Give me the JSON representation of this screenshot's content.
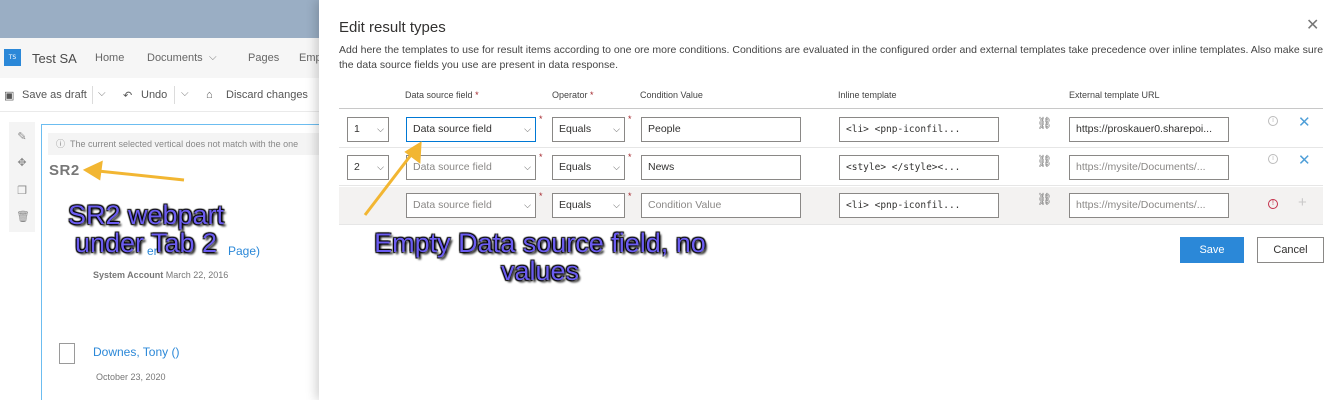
{
  "background_page": {
    "site_logo": "TS",
    "site_title": "Test SA",
    "nav_items": [
      "Home",
      "Documents",
      "Pages",
      "Emp"
    ],
    "commands": {
      "save_draft": "Save as draft",
      "undo": "Undo",
      "discard": "Discard changes"
    },
    "warning": "The current selected vertical does not match with the one",
    "webpart_title": "SR2",
    "ghost_link_1": "er",
    "ghost_link_2": "Page)",
    "item_author": "System Account",
    "item_date": "March 22, 2016",
    "doc_title": "Downes, Tony ()",
    "doc_date": "October 23, 2020"
  },
  "panel": {
    "title": "Edit result types",
    "close_icon": "close-icon",
    "description": "Add here the templates to use for result items according to one ore more conditions. Conditions are evaluated in the configured order and external templates take precedence over inline templates. Also make sure the data source fields you use are present in data response.",
    "columns": {
      "data_source_field": "Data source field",
      "operator": "Operator",
      "condition_value": "Condition Value",
      "inline_template": "Inline template",
      "external_template_url": "External template URL"
    },
    "rows": [
      {
        "order": "1",
        "data_source_field": "Data source field",
        "operator": "Equals",
        "condition_value": "People",
        "inline_template": "<li>    <pnp-iconfil...",
        "external_url": "https://proskauer0.sharepoi..."
      },
      {
        "order": "2",
        "data_source_field": "Data source field",
        "operator": "Equals",
        "condition_value": "News",
        "inline_template": "<style>    </style><...",
        "external_url": "https://mysite/Documents/..."
      }
    ],
    "new_row": {
      "data_source_field": "Data source field",
      "operator": "Equals",
      "condition_value_placeholder": "Condition Value",
      "inline_template": "<li>    <pnp-iconfil...",
      "external_url_placeholder": "https://mysite/Documents/..."
    },
    "save_label": "Save",
    "cancel_label": "Cancel"
  },
  "annotations": {
    "webpart_note": "SR2 webpart under Tab 2",
    "field_note": "Empty Data source field, no values",
    "arrow_color": "#f2b632",
    "text_color": "#6b5cf0"
  },
  "colors": {
    "accent": "#2b88d8",
    "required": "#a4262c",
    "error": "#c4314b",
    "topbar": "#9aaec4"
  }
}
